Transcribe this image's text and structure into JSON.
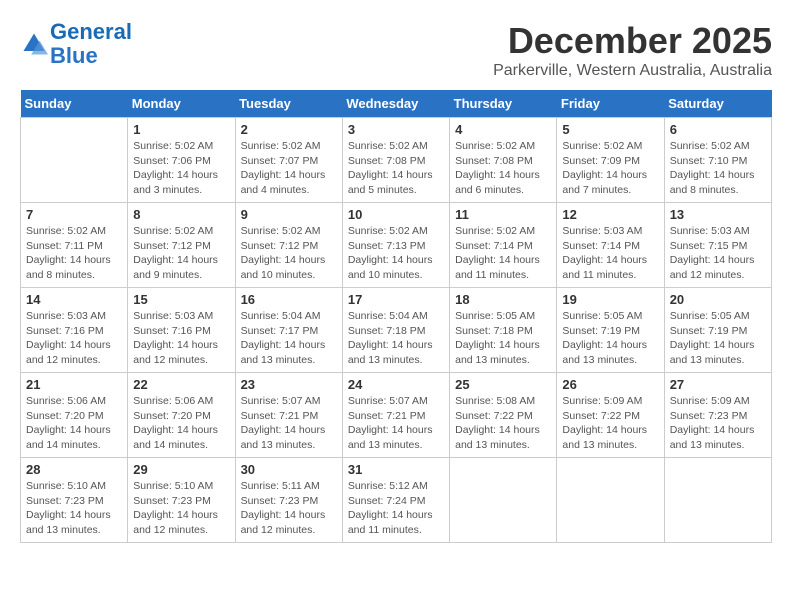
{
  "header": {
    "logo_line1": "General",
    "logo_line2": "Blue",
    "month": "December 2025",
    "location": "Parkerville, Western Australia, Australia"
  },
  "weekdays": [
    "Sunday",
    "Monday",
    "Tuesday",
    "Wednesday",
    "Thursday",
    "Friday",
    "Saturday"
  ],
  "weeks": [
    [
      {
        "day": "",
        "info": ""
      },
      {
        "day": "1",
        "info": "Sunrise: 5:02 AM\nSunset: 7:06 PM\nDaylight: 14 hours\nand 3 minutes."
      },
      {
        "day": "2",
        "info": "Sunrise: 5:02 AM\nSunset: 7:07 PM\nDaylight: 14 hours\nand 4 minutes."
      },
      {
        "day": "3",
        "info": "Sunrise: 5:02 AM\nSunset: 7:08 PM\nDaylight: 14 hours\nand 5 minutes."
      },
      {
        "day": "4",
        "info": "Sunrise: 5:02 AM\nSunset: 7:08 PM\nDaylight: 14 hours\nand 6 minutes."
      },
      {
        "day": "5",
        "info": "Sunrise: 5:02 AM\nSunset: 7:09 PM\nDaylight: 14 hours\nand 7 minutes."
      },
      {
        "day": "6",
        "info": "Sunrise: 5:02 AM\nSunset: 7:10 PM\nDaylight: 14 hours\nand 8 minutes."
      }
    ],
    [
      {
        "day": "7",
        "info": "Sunrise: 5:02 AM\nSunset: 7:11 PM\nDaylight: 14 hours\nand 8 minutes."
      },
      {
        "day": "8",
        "info": "Sunrise: 5:02 AM\nSunset: 7:12 PM\nDaylight: 14 hours\nand 9 minutes."
      },
      {
        "day": "9",
        "info": "Sunrise: 5:02 AM\nSunset: 7:12 PM\nDaylight: 14 hours\nand 10 minutes."
      },
      {
        "day": "10",
        "info": "Sunrise: 5:02 AM\nSunset: 7:13 PM\nDaylight: 14 hours\nand 10 minutes."
      },
      {
        "day": "11",
        "info": "Sunrise: 5:02 AM\nSunset: 7:14 PM\nDaylight: 14 hours\nand 11 minutes."
      },
      {
        "day": "12",
        "info": "Sunrise: 5:03 AM\nSunset: 7:14 PM\nDaylight: 14 hours\nand 11 minutes."
      },
      {
        "day": "13",
        "info": "Sunrise: 5:03 AM\nSunset: 7:15 PM\nDaylight: 14 hours\nand 12 minutes."
      }
    ],
    [
      {
        "day": "14",
        "info": "Sunrise: 5:03 AM\nSunset: 7:16 PM\nDaylight: 14 hours\nand 12 minutes."
      },
      {
        "day": "15",
        "info": "Sunrise: 5:03 AM\nSunset: 7:16 PM\nDaylight: 14 hours\nand 12 minutes."
      },
      {
        "day": "16",
        "info": "Sunrise: 5:04 AM\nSunset: 7:17 PM\nDaylight: 14 hours\nand 13 minutes."
      },
      {
        "day": "17",
        "info": "Sunrise: 5:04 AM\nSunset: 7:18 PM\nDaylight: 14 hours\nand 13 minutes."
      },
      {
        "day": "18",
        "info": "Sunrise: 5:05 AM\nSunset: 7:18 PM\nDaylight: 14 hours\nand 13 minutes."
      },
      {
        "day": "19",
        "info": "Sunrise: 5:05 AM\nSunset: 7:19 PM\nDaylight: 14 hours\nand 13 minutes."
      },
      {
        "day": "20",
        "info": "Sunrise: 5:05 AM\nSunset: 7:19 PM\nDaylight: 14 hours\nand 13 minutes."
      }
    ],
    [
      {
        "day": "21",
        "info": "Sunrise: 5:06 AM\nSunset: 7:20 PM\nDaylight: 14 hours\nand 14 minutes."
      },
      {
        "day": "22",
        "info": "Sunrise: 5:06 AM\nSunset: 7:20 PM\nDaylight: 14 hours\nand 14 minutes."
      },
      {
        "day": "23",
        "info": "Sunrise: 5:07 AM\nSunset: 7:21 PM\nDaylight: 14 hours\nand 13 minutes."
      },
      {
        "day": "24",
        "info": "Sunrise: 5:07 AM\nSunset: 7:21 PM\nDaylight: 14 hours\nand 13 minutes."
      },
      {
        "day": "25",
        "info": "Sunrise: 5:08 AM\nSunset: 7:22 PM\nDaylight: 14 hours\nand 13 minutes."
      },
      {
        "day": "26",
        "info": "Sunrise: 5:09 AM\nSunset: 7:22 PM\nDaylight: 14 hours\nand 13 minutes."
      },
      {
        "day": "27",
        "info": "Sunrise: 5:09 AM\nSunset: 7:23 PM\nDaylight: 14 hours\nand 13 minutes."
      }
    ],
    [
      {
        "day": "28",
        "info": "Sunrise: 5:10 AM\nSunset: 7:23 PM\nDaylight: 14 hours\nand 13 minutes."
      },
      {
        "day": "29",
        "info": "Sunrise: 5:10 AM\nSunset: 7:23 PM\nDaylight: 14 hours\nand 12 minutes."
      },
      {
        "day": "30",
        "info": "Sunrise: 5:11 AM\nSunset: 7:23 PM\nDaylight: 14 hours\nand 12 minutes."
      },
      {
        "day": "31",
        "info": "Sunrise: 5:12 AM\nSunset: 7:24 PM\nDaylight: 14 hours\nand 11 minutes."
      },
      {
        "day": "",
        "info": ""
      },
      {
        "day": "",
        "info": ""
      },
      {
        "day": "",
        "info": ""
      }
    ]
  ]
}
